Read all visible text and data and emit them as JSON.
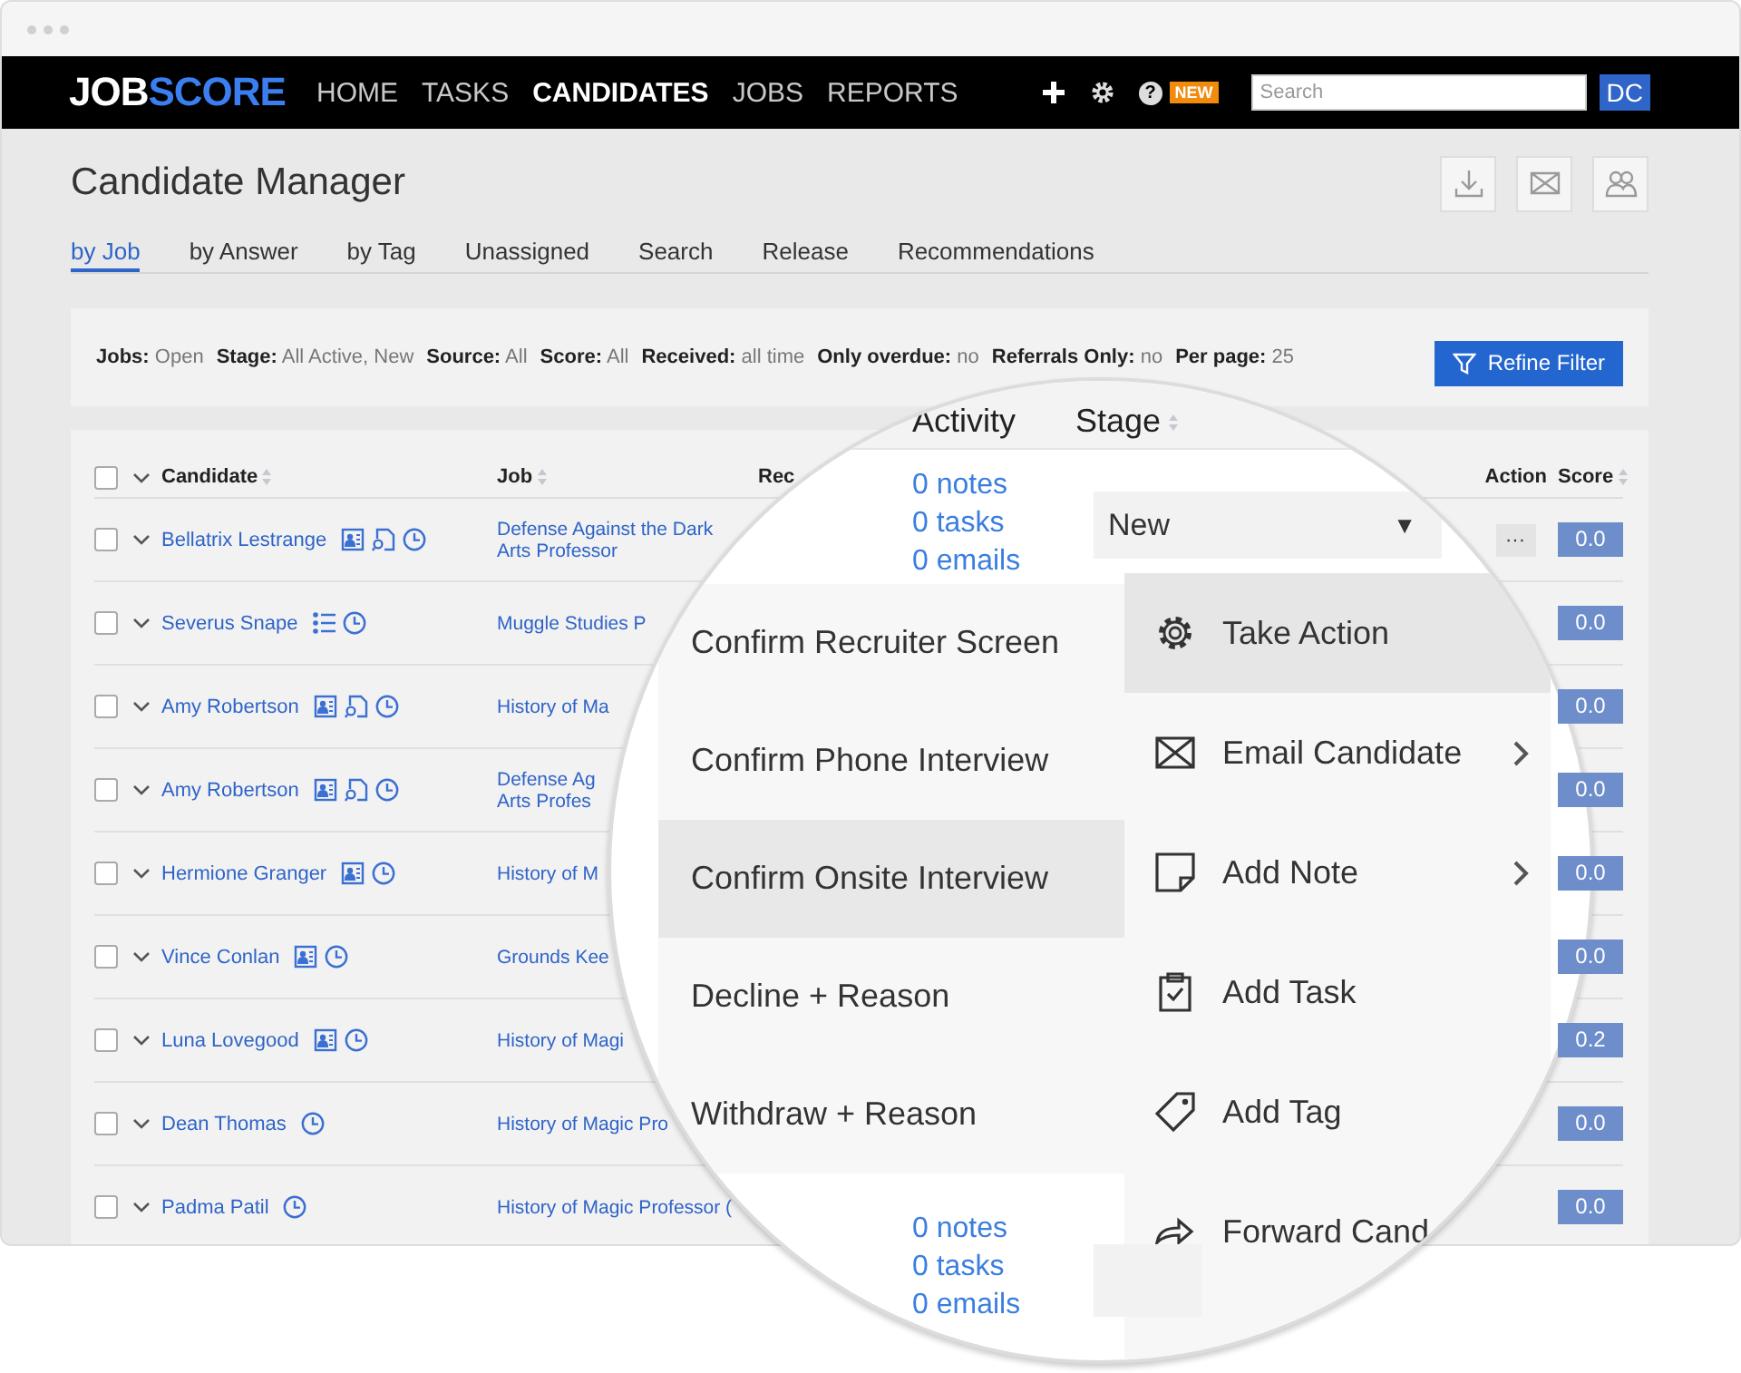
{
  "nav": {
    "logo": {
      "first": "JOB",
      "second": "SCORE"
    },
    "links": [
      {
        "label": "HOME",
        "selected": false
      },
      {
        "label": "TASKS",
        "selected": false
      },
      {
        "label": "CANDIDATES",
        "selected": true
      },
      {
        "label": "JOBS",
        "selected": false
      },
      {
        "label": "REPORTS",
        "selected": false
      }
    ],
    "help": "?",
    "badge": "NEW",
    "search": {
      "placeholder": "Search"
    },
    "user": "DC"
  },
  "page": {
    "title": "Candidate Manager",
    "tabs": [
      {
        "label": "by Job",
        "selected": true
      },
      {
        "label": "by Answer",
        "selected": false
      },
      {
        "label": "by Tag",
        "selected": false
      },
      {
        "label": "Unassigned",
        "selected": false
      },
      {
        "label": "Search",
        "selected": false
      },
      {
        "label": "Release",
        "selected": false
      },
      {
        "label": "Recommendations",
        "selected": false
      }
    ]
  },
  "filters": [
    {
      "label": "Jobs:",
      "value": "Open"
    },
    {
      "label": "Stage:",
      "value": "All Active, New"
    },
    {
      "label": "Source:",
      "value": "All"
    },
    {
      "label": "Score:",
      "value": "All"
    },
    {
      "label": "Received:",
      "value": "all time"
    },
    {
      "label": "Only overdue:",
      "value": "no"
    },
    {
      "label": "Referrals Only:",
      "value": "no"
    },
    {
      "label": "Per page:",
      "value": "25"
    }
  ],
  "refine_button": "Refine Filter",
  "table": {
    "all_checked": false,
    "columns": [
      {
        "label": "Candidate",
        "sortable": true
      },
      {
        "label": "Job",
        "sortable": true
      },
      {
        "label": "Rec",
        "sortable": false
      },
      {
        "label": "Action",
        "sortable": false
      },
      {
        "label": "Score",
        "sortable": true
      }
    ],
    "rows": [
      {
        "checked": false,
        "name": "Bellatrix Lestrange",
        "icons": [
          {
            "kind": "profile"
          },
          {
            "kind": "file"
          },
          {
            "kind": "timer"
          }
        ],
        "job": "Defense Against the Dark\nArts Professor",
        "action": "···",
        "score": "0.0"
      },
      {
        "checked": false,
        "name": "Severus Snape",
        "icons": [
          {
            "kind": "list"
          },
          {
            "kind": "timer"
          }
        ],
        "job": "Muggle Studies P",
        "score": "0.0"
      },
      {
        "checked": false,
        "name": "Amy Robertson",
        "icons": [
          {
            "kind": "profile"
          },
          {
            "kind": "file"
          },
          {
            "kind": "timer"
          }
        ],
        "job": "History of Ma",
        "score": "0.0"
      },
      {
        "checked": false,
        "name": "Amy Robertson",
        "icons": [
          {
            "kind": "profile"
          },
          {
            "kind": "file"
          },
          {
            "kind": "timer"
          }
        ],
        "job": "Defense Ag\nArts Profes",
        "score": "0.0"
      },
      {
        "checked": false,
        "name": "Hermione Granger",
        "icons": [
          {
            "kind": "profile"
          },
          {
            "kind": "timer"
          }
        ],
        "job": "History of M",
        "score": "0.0"
      },
      {
        "checked": false,
        "name": "Vince Conlan",
        "icons": [
          {
            "kind": "profile"
          },
          {
            "kind": "timer"
          }
        ],
        "job": "Grounds Kee",
        "score": "0.0"
      },
      {
        "checked": false,
        "name": "Luna Lovegood",
        "icons": [
          {
            "kind": "profile"
          },
          {
            "kind": "timer"
          }
        ],
        "job": "History of Magi",
        "score": "0.2"
      },
      {
        "checked": false,
        "name": "Dean Thomas",
        "icons": [
          {
            "kind": "timer"
          }
        ],
        "job": "History of Magic Pro",
        "score": "0.0"
      },
      {
        "checked": false,
        "name": "Padma Patil",
        "icons": [
          {
            "kind": "timer"
          }
        ],
        "job": "History of Magic Professor (",
        "score": "0.0"
      }
    ]
  },
  "magnifier": {
    "columns": [
      {
        "label": "Activity",
        "sortable": false
      },
      {
        "label": "Stage",
        "sortable": true
      }
    ],
    "activity": [
      "0 notes",
      "0 tasks",
      "0 emails"
    ],
    "stage": {
      "value": "New",
      "arrow": "▼"
    },
    "stage_menu": [
      {
        "label": "Confirm Recruiter Screen",
        "selected": false
      },
      {
        "label": "Confirm Phone Interview",
        "selected": false
      },
      {
        "label": "Confirm Onsite Interview",
        "selected": true
      },
      {
        "label": "Decline + Reason",
        "selected": false
      },
      {
        "label": "Withdraw + Reason",
        "selected": false
      }
    ],
    "action_menu": [
      {
        "label": "Take Action",
        "kind": "settings",
        "submenu": false,
        "selected": true
      },
      {
        "label": "Email Candidate",
        "kind": "email",
        "submenu": true,
        "selected": false
      },
      {
        "label": "Add Note",
        "kind": "note",
        "submenu": true,
        "selected": false
      },
      {
        "label": "Add Task",
        "kind": "task",
        "submenu": false,
        "selected": false
      },
      {
        "label": "Add Tag",
        "kind": "tag",
        "submenu": false,
        "selected": false
      },
      {
        "label": "Forward Cand",
        "kind": "forward",
        "selected": false
      }
    ],
    "activity_next": [
      "0 notes",
      "0 tasks",
      "0 emails"
    ]
  }
}
